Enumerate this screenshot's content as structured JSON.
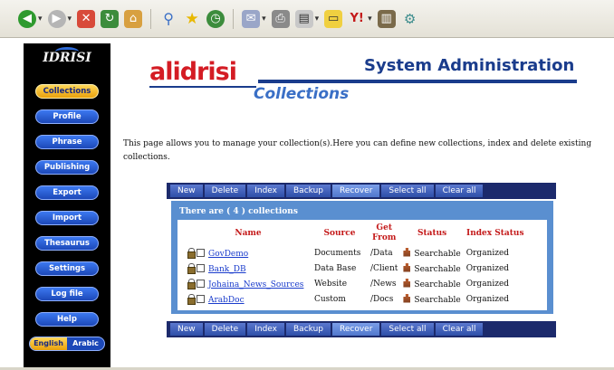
{
  "toolbar": {
    "icons": [
      "back-icon",
      "forward-icon",
      "stop-icon",
      "refresh-icon",
      "home-icon",
      "search-icon",
      "favorites-icon",
      "history-icon",
      "mail-icon",
      "print-icon",
      "edit-icon",
      "notes-icon",
      "messenger-icon",
      "research-icon",
      "tools-icon"
    ]
  },
  "sidebar": {
    "brand": "IDRISI",
    "items": [
      {
        "label": "Collections",
        "active": true
      },
      {
        "label": "Profile"
      },
      {
        "label": "Phrase"
      },
      {
        "label": "Publishing"
      },
      {
        "label": "Export"
      },
      {
        "label": "Import"
      },
      {
        "label": "Thesaurus"
      },
      {
        "label": "Settings"
      },
      {
        "label": "Log file"
      },
      {
        "label": "Help"
      }
    ],
    "lang": {
      "english": "English",
      "arabic": "Arabic"
    }
  },
  "header": {
    "logo": "alidrisi",
    "title": "System Administration",
    "subtitle": "Collections"
  },
  "description": "This page allows you to manage your collection(s).Here you can define new collections, index and delete existing collections.",
  "actions": [
    "New",
    "Delete",
    "Index",
    "Backup",
    "Recover",
    "Select all",
    "Clear all"
  ],
  "panel": {
    "heading": "There are ( 4 ) collections",
    "columns": {
      "name": "Name",
      "source": "Source",
      "get_from": "Get From",
      "status": "Status",
      "index_status": "Index Status"
    },
    "rows": [
      {
        "name": "GovDemo",
        "source": "Documents",
        "get_from": "/Data",
        "status": "Searchable",
        "index_status": "Organized"
      },
      {
        "name": "Bank_DB",
        "source": "Data Base",
        "get_from": "/Client",
        "status": "Searchable",
        "index_status": "Organized"
      },
      {
        "name": "Johaina_News_Sources",
        "source": "Website",
        "get_from": "/News",
        "status": "Searchable",
        "index_status": "Organized"
      },
      {
        "name": "ArabDoc",
        "source": "Custom",
        "get_from": "/Docs",
        "status": "Searchable",
        "index_status": "Organized"
      }
    ]
  },
  "colors": {
    "accent_blue": "#1a3c8c",
    "logo_red": "#d41c24",
    "panel_blue": "#5a8fd0",
    "active_gold": "#e8a10c"
  }
}
